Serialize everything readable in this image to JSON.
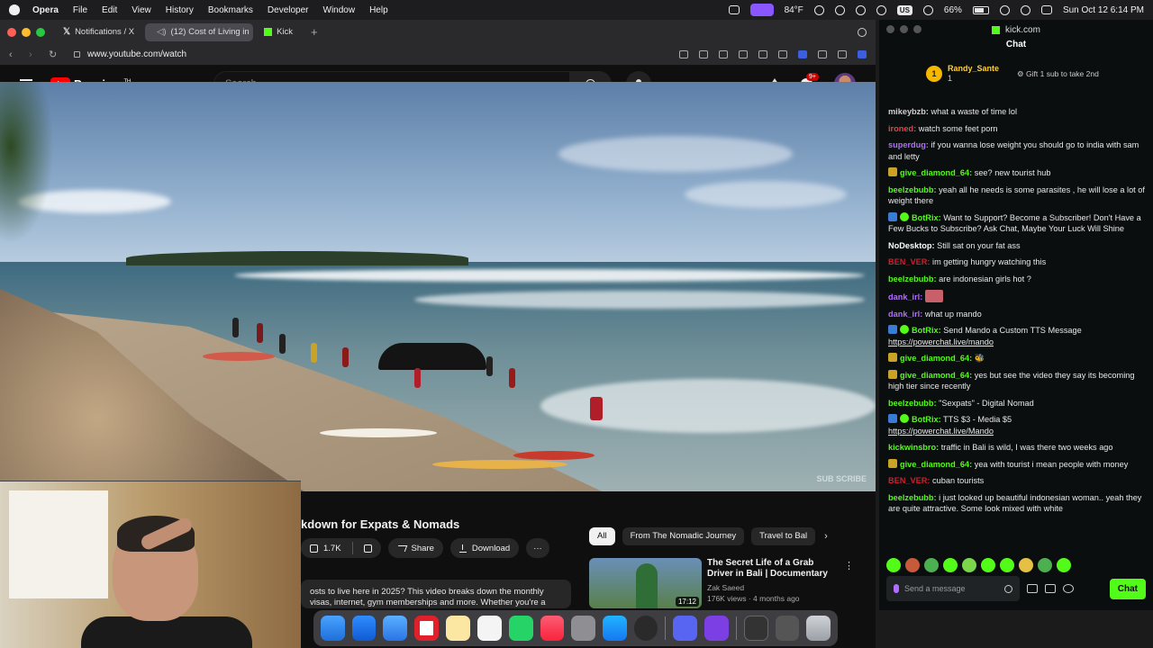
{
  "menubar": {
    "app": "Opera",
    "items": [
      "File",
      "Edit",
      "View",
      "History",
      "Bookmarks",
      "Developer",
      "Window",
      "Help"
    ],
    "weather": "84°F",
    "battery": "66%",
    "keyboard": "US",
    "datetime": "Sun Oct 12  6:14 PM"
  },
  "browser": {
    "tabs": [
      {
        "label": "Notifications / X"
      },
      {
        "label": "(12) Cost of Living in"
      },
      {
        "label": "Kick"
      }
    ],
    "url": "www.youtube.com/watch"
  },
  "youtube": {
    "brand": "Premium",
    "brand_sup": "TH",
    "search_placeholder": "Search",
    "notif_count": "9+",
    "video_watermark": "SUB\nSCRIBE",
    "title": "kdown for Expats & Nomads",
    "like_count": "1.7K",
    "share_label": "Share",
    "download_label": "Download",
    "more_label": "···",
    "description": "osts to live here in 2025? This video breaks down the monthly\n visas, internet, gym memberships and more. Whether you're a",
    "chips": [
      "All",
      "From The Nomadic Journey",
      "Travel to Bal"
    ],
    "chip_next": "›",
    "recommendation": {
      "title": "The Secret Life of a Grab Driver in Bali | Documentary",
      "channel": "Zak Saeed",
      "meta": "176K views · 4 months ago",
      "duration": "17:12"
    }
  },
  "chat_window": {
    "domain": "kick.com",
    "header": "Chat",
    "pinned": {
      "rank": "1",
      "user": "Randy_Sante",
      "count": "1",
      "gift_text": "Gift 1 sub to take 2nd"
    },
    "messages": [
      {
        "user": "mikeybzb:",
        "text": " what a waste of time lol",
        "color": "#cfcfcf"
      },
      {
        "user": "ironed:",
        "text": " watch some feet porn",
        "color": "#d8484e"
      },
      {
        "user": "superdug:",
        "text": " if you wanna lose weight you should go to india with sam and letty",
        "color": "#b26cff"
      },
      {
        "user": "give_diamond_64:",
        "text": " see? new tourist hub",
        "color": "#53fc18",
        "badge": "#c9a227"
      },
      {
        "user": "beelzebubb:",
        "text": " yeah all he needs is some parasites , he will lose a lot of weight there",
        "color": "#53fc18"
      },
      {
        "user": "BotRix:",
        "text": " Want to Support? Become a Subscriber! Don't Have a Few Bucks to Subscribe? Ask Chat, Maybe Your Luck Will Shine",
        "color": "#53fc18",
        "badge": "#3a7bd5"
      },
      {
        "user": "NoDesktop:",
        "text": " Still sat on your fat ass",
        "color": "#ffffff"
      },
      {
        "user": "BEN_VER:",
        "text": " im getting hungry watching this",
        "color": "#d11d2b"
      },
      {
        "user": "beelzebubb:",
        "text": " are indonesian girls hot ?",
        "color": "#53fc18"
      },
      {
        "user": "dank_irl:",
        "text": " ",
        "color": "#b26cff",
        "emote": true
      },
      {
        "user": "dank_irl:",
        "text": " what up mando",
        "color": "#b26cff"
      },
      {
        "user": "BotRix:",
        "text": " Send Mando a Custom TTS Message",
        "color": "#53fc18",
        "badge": "#3a7bd5",
        "link": "https://powerchat.live/mando"
      },
      {
        "user": "give_diamond_64:",
        "text": " 🐝",
        "color": "#53fc18",
        "badge": "#c9a227"
      },
      {
        "user": "give_diamond_64:",
        "text": " yes but see the video they say its becoming high tier since recently",
        "color": "#53fc18",
        "badge": "#c9a227"
      },
      {
        "user": "beelzebubb:",
        "text": " \"Sexpats\" - Digital Nomad",
        "color": "#53fc18"
      },
      {
        "user": "BotRix:",
        "text": " TTS $3 - Media $5",
        "color": "#53fc18",
        "badge": "#3a7bd5",
        "link": "https://powerchat.live/Mando"
      },
      {
        "user": "kickwinsbro:",
        "text": " traffic in Bali is wild, I was there two weeks ago",
        "color": "#53fc18"
      },
      {
        "user": "give_diamond_64:",
        "text": " yea with tourist i mean people with money",
        "color": "#53fc18",
        "badge": "#c9a227"
      },
      {
        "user": "BEN_VER:",
        "text": " cuban tourists",
        "color": "#d11d2b"
      },
      {
        "user": "beelzebubb:",
        "text": " i just looked up beautiful indonesian woman.. yeah they are quite attractive. Some look mixed with white",
        "color": "#53fc18"
      }
    ],
    "send_placeholder": "Send a message",
    "chat_button": "Chat"
  }
}
